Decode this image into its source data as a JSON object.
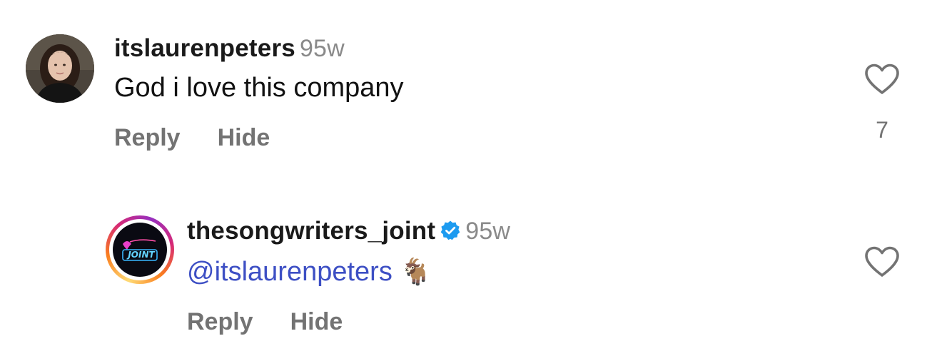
{
  "comments": [
    {
      "username": "itslaurenpeters",
      "time": "95w",
      "text": "God i love this company",
      "reply_label": "Reply",
      "hide_label": "Hide",
      "like_count": "7"
    },
    {
      "username": "thesongwriters_joint",
      "verified": true,
      "time": "95w",
      "mention": "@itslaurenpeters",
      "emoji": "🐐",
      "reply_label": "Reply",
      "hide_label": "Hide",
      "avatar_text": "JOINT"
    }
  ],
  "colors": {
    "mention": "#3d4fc4",
    "muted": "#737373",
    "verified": "#1d9bf0"
  }
}
